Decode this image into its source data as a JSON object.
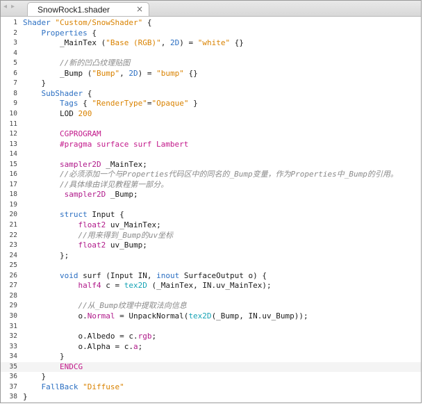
{
  "tab": {
    "title": "SnowRock1.shader",
    "close_glyph": "×"
  },
  "nav": {
    "back_glyph": "◂",
    "forward_glyph": "▸"
  },
  "lines": [
    {
      "n": "1",
      "segs": [
        {
          "t": "Shader ",
          "c": "kw"
        },
        {
          "t": "\"Custom/SnowShader\"",
          "c": "str"
        },
        {
          "t": " {",
          "c": "op"
        }
      ]
    },
    {
      "n": "2",
      "segs": [
        {
          "t": "    Properties",
          "c": "kw"
        },
        {
          "t": " {",
          "c": "op"
        }
      ]
    },
    {
      "n": "3",
      "segs": [
        {
          "t": "        _MainTex (",
          "c": "id"
        },
        {
          "t": "\"Base (RGB)\"",
          "c": "str"
        },
        {
          "t": ", ",
          "c": "op"
        },
        {
          "t": "2D",
          "c": "kw"
        },
        {
          "t": ") = ",
          "c": "op"
        },
        {
          "t": "\"white\"",
          "c": "str"
        },
        {
          "t": " {}",
          "c": "op"
        }
      ]
    },
    {
      "n": "4",
      "segs": []
    },
    {
      "n": "5",
      "segs": [
        {
          "t": "        //新的凹凸纹理贴图",
          "c": "cm"
        }
      ]
    },
    {
      "n": "6",
      "segs": [
        {
          "t": "        _Bump (",
          "c": "id"
        },
        {
          "t": "\"Bump\"",
          "c": "str"
        },
        {
          "t": ", ",
          "c": "op"
        },
        {
          "t": "2D",
          "c": "kw"
        },
        {
          "t": ") = ",
          "c": "op"
        },
        {
          "t": "\"bump\"",
          "c": "str"
        },
        {
          "t": " {}",
          "c": "op"
        }
      ]
    },
    {
      "n": "7",
      "segs": [
        {
          "t": "    }",
          "c": "op"
        }
      ]
    },
    {
      "n": "8",
      "segs": [
        {
          "t": "    SubShader",
          "c": "kw"
        },
        {
          "t": " {",
          "c": "op"
        }
      ]
    },
    {
      "n": "9",
      "segs": [
        {
          "t": "        Tags",
          "c": "kw"
        },
        {
          "t": " { ",
          "c": "op"
        },
        {
          "t": "\"RenderType\"",
          "c": "str"
        },
        {
          "t": "=",
          "c": "op"
        },
        {
          "t": "\"Opaque\"",
          "c": "str"
        },
        {
          "t": " }",
          "c": "op"
        }
      ]
    },
    {
      "n": "10",
      "segs": [
        {
          "t": "        LOD ",
          "c": "id"
        },
        {
          "t": "200",
          "c": "num"
        }
      ]
    },
    {
      "n": "11",
      "segs": []
    },
    {
      "n": "12",
      "segs": [
        {
          "t": "        CGPROGRAM",
          "c": "pre"
        }
      ]
    },
    {
      "n": "13",
      "segs": [
        {
          "t": "        #pragma surface surf Lambert",
          "c": "pre"
        }
      ]
    },
    {
      "n": "14",
      "segs": []
    },
    {
      "n": "15",
      "segs": [
        {
          "t": "        sampler2D",
          "c": "type"
        },
        {
          "t": " _MainTex;",
          "c": "id"
        }
      ]
    },
    {
      "n": "16",
      "segs": [
        {
          "t": "        //必须添加一个与Properties代码区中的同名的_Bump变量，作为Properties中_Bump的引用。",
          "c": "cm"
        }
      ]
    },
    {
      "n": "17",
      "segs": [
        {
          "t": "        //具体缘由详见教程第一部分。",
          "c": "cm"
        }
      ]
    },
    {
      "n": "18",
      "segs": [
        {
          "t": "         sampler2D",
          "c": "type"
        },
        {
          "t": " _Bump;",
          "c": "id"
        }
      ]
    },
    {
      "n": "19",
      "segs": []
    },
    {
      "n": "20",
      "segs": [
        {
          "t": "        struct",
          "c": "kw"
        },
        {
          "t": " Input {",
          "c": "id"
        }
      ]
    },
    {
      "n": "21",
      "segs": [
        {
          "t": "            float2",
          "c": "type"
        },
        {
          "t": " uv_MainTex;",
          "c": "id"
        }
      ]
    },
    {
      "n": "22",
      "segs": [
        {
          "t": "            //用来得到_Bump的uv坐标",
          "c": "cm"
        }
      ]
    },
    {
      "n": "23",
      "segs": [
        {
          "t": "            float2",
          "c": "type"
        },
        {
          "t": " uv_Bump;",
          "c": "id"
        }
      ]
    },
    {
      "n": "24",
      "segs": [
        {
          "t": "        };",
          "c": "op"
        }
      ]
    },
    {
      "n": "25",
      "segs": []
    },
    {
      "n": "26",
      "segs": [
        {
          "t": "        void",
          "c": "kw"
        },
        {
          "t": " surf (Input IN, ",
          "c": "id"
        },
        {
          "t": "inout",
          "c": "kw"
        },
        {
          "t": " SurfaceOutput o) {",
          "c": "id"
        }
      ]
    },
    {
      "n": "27",
      "segs": [
        {
          "t": "            half4",
          "c": "type"
        },
        {
          "t": " c = ",
          "c": "id"
        },
        {
          "t": "tex2D",
          "c": "fn"
        },
        {
          "t": " (_MainTex, IN.uv_MainTex);",
          "c": "id"
        }
      ]
    },
    {
      "n": "28",
      "segs": []
    },
    {
      "n": "29",
      "segs": [
        {
          "t": "            //从_Bump纹理中提取法向信息",
          "c": "cm"
        }
      ]
    },
    {
      "n": "30",
      "segs": [
        {
          "t": "            o.",
          "c": "id"
        },
        {
          "t": "Normal",
          "c": "mem"
        },
        {
          "t": " = UnpackNormal(",
          "c": "id"
        },
        {
          "t": "tex2D",
          "c": "fn"
        },
        {
          "t": "(_Bump, IN.uv_Bump));",
          "c": "id"
        }
      ]
    },
    {
      "n": "31",
      "segs": []
    },
    {
      "n": "32",
      "segs": [
        {
          "t": "            o.Albedo = c.",
          "c": "id"
        },
        {
          "t": "rgb",
          "c": "mem"
        },
        {
          "t": ";",
          "c": "op"
        }
      ]
    },
    {
      "n": "33",
      "segs": [
        {
          "t": "            o.Alpha = c.",
          "c": "id"
        },
        {
          "t": "a",
          "c": "mem"
        },
        {
          "t": ";",
          "c": "op"
        }
      ]
    },
    {
      "n": "34",
      "segs": [
        {
          "t": "        }",
          "c": "op"
        }
      ]
    },
    {
      "n": "35",
      "segs": [
        {
          "t": "        ENDCG",
          "c": "pre"
        }
      ]
    },
    {
      "n": "36",
      "segs": [
        {
          "t": "    }",
          "c": "op"
        }
      ]
    },
    {
      "n": "37",
      "segs": [
        {
          "t": "    FallBack ",
          "c": "kw"
        },
        {
          "t": "\"Diffuse\"",
          "c": "str"
        }
      ]
    },
    {
      "n": "38",
      "segs": [
        {
          "t": "}",
          "c": "op"
        }
      ]
    }
  ],
  "colors": {
    "keyword": "#2b6fc2",
    "string": "#d98200",
    "comment": "#8a8a8a",
    "preprocessor": "#c2188a",
    "type": "#b0198a",
    "function": "#16a3b5"
  }
}
